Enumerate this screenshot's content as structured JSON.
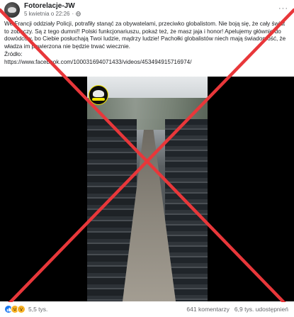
{
  "post": {
    "author": "Fotorelacje-JW",
    "date": "5 kwietnia o 22:26",
    "separator": "·",
    "more_label": "···",
    "text_paragraph": "We Francji oddziały Policji, potrafiły stanąć za obywatelami, przeciwko globalistom. Nie boją się, że cały świat to zobaczy. Są z tego dumni!! Polski funkcjonariuszu, pokaż też, że masz jaja i honor! Apelujemy głównie do dowódców, bo Ciebie posłuchają Twoi ludzie, mądrzy ludzie! Pachołki globalistów niech mają świadomość, że władza im powierzona nie będzie trwać wiecznie.",
    "source_label": "Źródło:",
    "source_link": "https://www.facebook.com/100031694071433/videos/453494915716974/"
  },
  "icons": {
    "globe": "globe-icon",
    "like": "like-icon",
    "haha": "haha-icon",
    "wow": "wow-icon"
  },
  "overlay": {
    "cross_color": "#e8373a"
  },
  "footer": {
    "reaction_count": "5,5 tys.",
    "comments": "641 komentarzy",
    "shares": "6,9 tys. udostępnień"
  }
}
